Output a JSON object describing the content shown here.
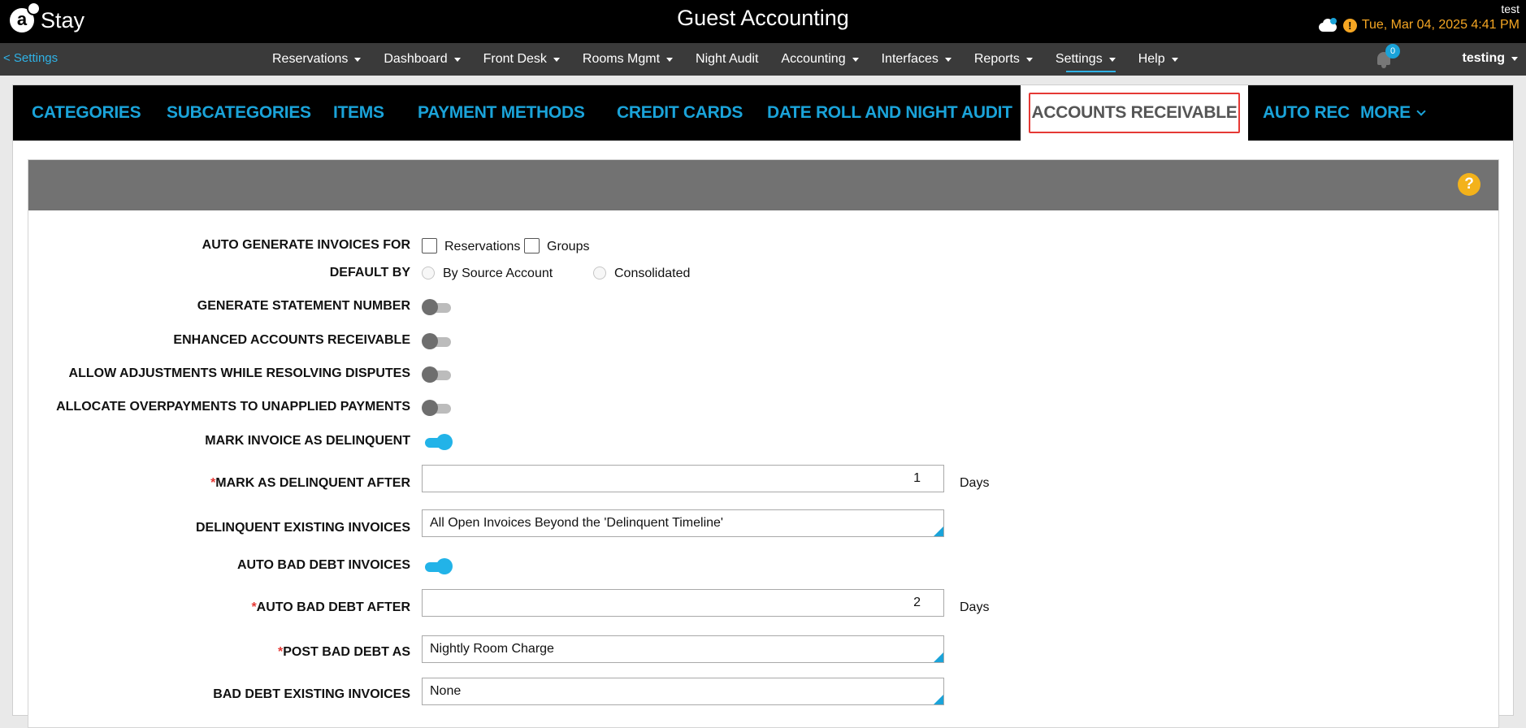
{
  "header": {
    "logo_glyph": "a",
    "logo_text": "Stay",
    "app_title": "Guest Accounting",
    "user_short": "test",
    "alert_glyph": "!",
    "datetime": "Tue, Mar 04, 2025 4:41 PM"
  },
  "nav": {
    "back_label": "< Settings",
    "items": [
      {
        "label": "Reservations",
        "dropdown": true
      },
      {
        "label": "Dashboard",
        "dropdown": true
      },
      {
        "label": "Front Desk",
        "dropdown": true
      },
      {
        "label": "Rooms Mgmt",
        "dropdown": true
      },
      {
        "label": "Night Audit",
        "dropdown": false
      },
      {
        "label": "Accounting",
        "dropdown": true
      },
      {
        "label": "Interfaces",
        "dropdown": true
      },
      {
        "label": "Reports",
        "dropdown": true
      },
      {
        "label": "Settings",
        "dropdown": true,
        "active": true
      },
      {
        "label": "Help",
        "dropdown": true
      }
    ],
    "notification_count": "0",
    "user_menu_label": "testing"
  },
  "tabs": {
    "items": [
      {
        "label": "CATEGORIES"
      },
      {
        "label": "SUBCATEGORIES"
      },
      {
        "label": "ITEMS"
      },
      {
        "label": "PAYMENT METHODS"
      },
      {
        "label": "CREDIT CARDS"
      },
      {
        "label": "DATE ROLL AND NIGHT AUDIT"
      },
      {
        "label": "ACCOUNTS RECEIVABLE",
        "active": true
      },
      {
        "label": "AUTO REC"
      },
      {
        "label": "MORE"
      }
    ]
  },
  "panel": {
    "help_glyph": "?"
  },
  "form": {
    "auto_generate": {
      "label": "AUTO GENERATE INVOICES FOR",
      "options": [
        {
          "label": "Reservations",
          "checked": false
        },
        {
          "label": "Groups",
          "checked": false
        }
      ]
    },
    "default_by": {
      "label": "DEFAULT BY",
      "options": [
        {
          "label": "By Source Account",
          "selected": false
        },
        {
          "label": "Consolidated",
          "selected": false
        }
      ]
    },
    "toggles": [
      {
        "label": "GENERATE STATEMENT NUMBER",
        "on": false
      },
      {
        "label": "ENHANCED ACCOUNTS RECEIVABLE",
        "on": false
      },
      {
        "label": "ALLOW ADJUSTMENTS WHILE RESOLVING DISPUTES",
        "on": false
      },
      {
        "label": "ALLOCATE OVERPAYMENTS TO UNAPPLIED PAYMENTS",
        "on": false
      },
      {
        "label": "MARK INVOICE AS DELINQUENT",
        "on": true
      }
    ],
    "required_mark": "*",
    "delinquent_after": {
      "label": "MARK AS DELINQUENT AFTER",
      "value": "1",
      "unit": "Days"
    },
    "delinquent_existing": {
      "label": "DELINQUENT EXISTING INVOICES",
      "value": "All Open Invoices Beyond the 'Delinquent Timeline'"
    },
    "auto_bad_debt": {
      "label": "AUTO BAD DEBT INVOICES",
      "on": true
    },
    "bad_debt_after": {
      "label": "AUTO BAD DEBT AFTER",
      "value": "2",
      "unit": "Days"
    },
    "post_bad_debt": {
      "label": "POST BAD DEBT AS",
      "value": "Nightly Room Charge"
    },
    "bad_debt_existing": {
      "label": "BAD DEBT EXISTING INVOICES",
      "value": "None"
    }
  }
}
